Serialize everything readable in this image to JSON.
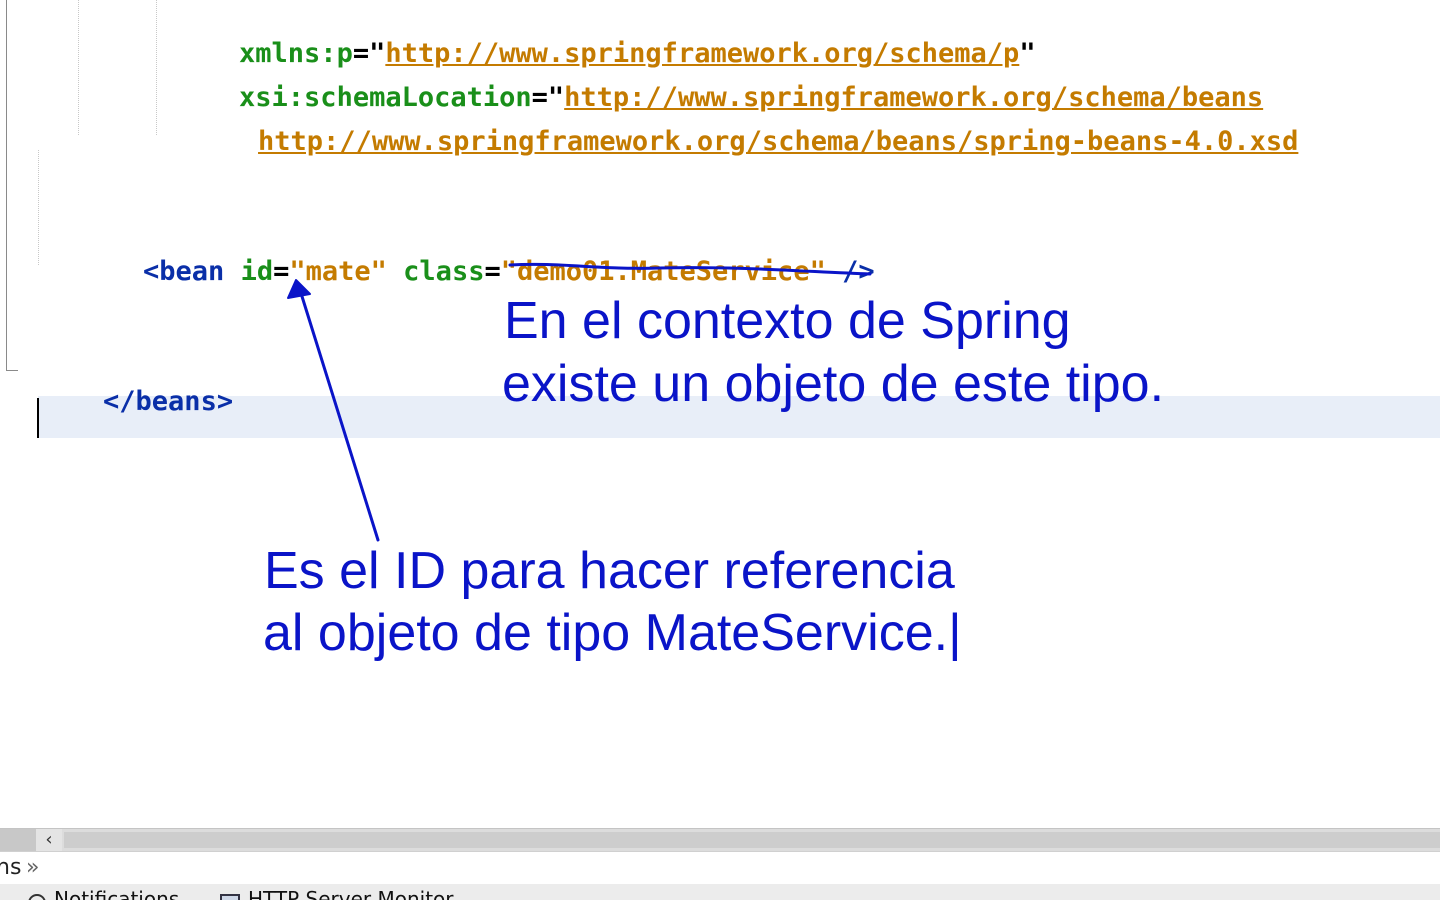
{
  "editor": {
    "lines": {
      "xmlns_p": {
        "attr": "xmlns:p",
        "eq": "=\"",
        "url": "http://www.springframework.org/schema/p",
        "close": "\""
      },
      "schema_location": {
        "attr": "xsi:schemaLocation",
        "eq": "=\"",
        "url": "http://www.springframework.org/schema/beans"
      },
      "schema_location_2": {
        "url": "http://www.springframework.org/schema/beans/spring-beans-4.0.xsd"
      },
      "bean": {
        "open": "<bean",
        "id_attr": "id",
        "eq1": "=",
        "id_value": "\"mate\"",
        "class_attr": "class",
        "eq2": "=",
        "class_value": "\"demo01.MateService\"",
        "close": "/>"
      },
      "beans_close": "</beans>"
    }
  },
  "annotations": {
    "class_note_line1": "En el contexto de Spring",
    "class_note_line2": "existe un objeto de este tipo.",
    "id_note_line1": "Es el ID para hacer referencia",
    "id_note_line2": "al objeto de tipo MateService.|",
    "color": "#0a14c8"
  },
  "scrollbar": {
    "left_arrow": "‹"
  },
  "breadcrumb": {
    "item": "ns",
    "separator": "»"
  },
  "bottom_tabs": [
    {
      "label": "Notifications",
      "icon": "notification-icon"
    },
    {
      "label": "HTTP Server Monitor",
      "icon": "http-monitor-icon"
    }
  ]
}
